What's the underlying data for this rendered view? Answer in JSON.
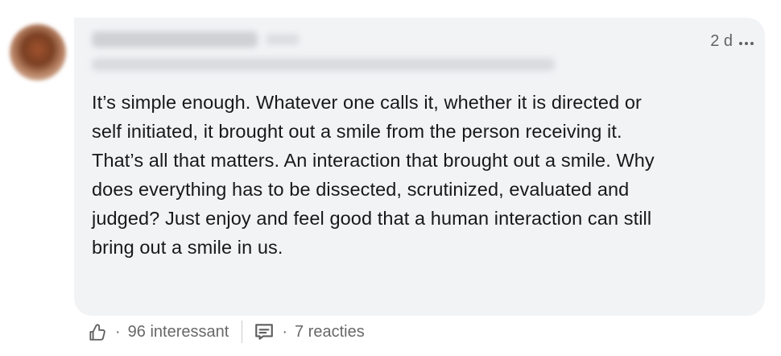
{
  "comment": {
    "timestamp": "2 d",
    "body": "It’s simple enough. Whatever one calls it, whether it is directed or\nself initiated, it brought out a smile from the person receiving it.\nThat’s all that matters. An interaction that brought out a smile.  Why\ndoes everything has to be dissected, scrutinized, evaluated and\njudged?  Just enjoy and feel good that a human interaction can still\nbring out a smile in us."
  },
  "social": {
    "separator": "·",
    "likes_label": "96 interessant",
    "replies_label": "7 reacties"
  },
  "icons": {
    "like": "like-thumb-icon",
    "reply": "comment-bubble-icon",
    "more": "more-options-icon"
  }
}
